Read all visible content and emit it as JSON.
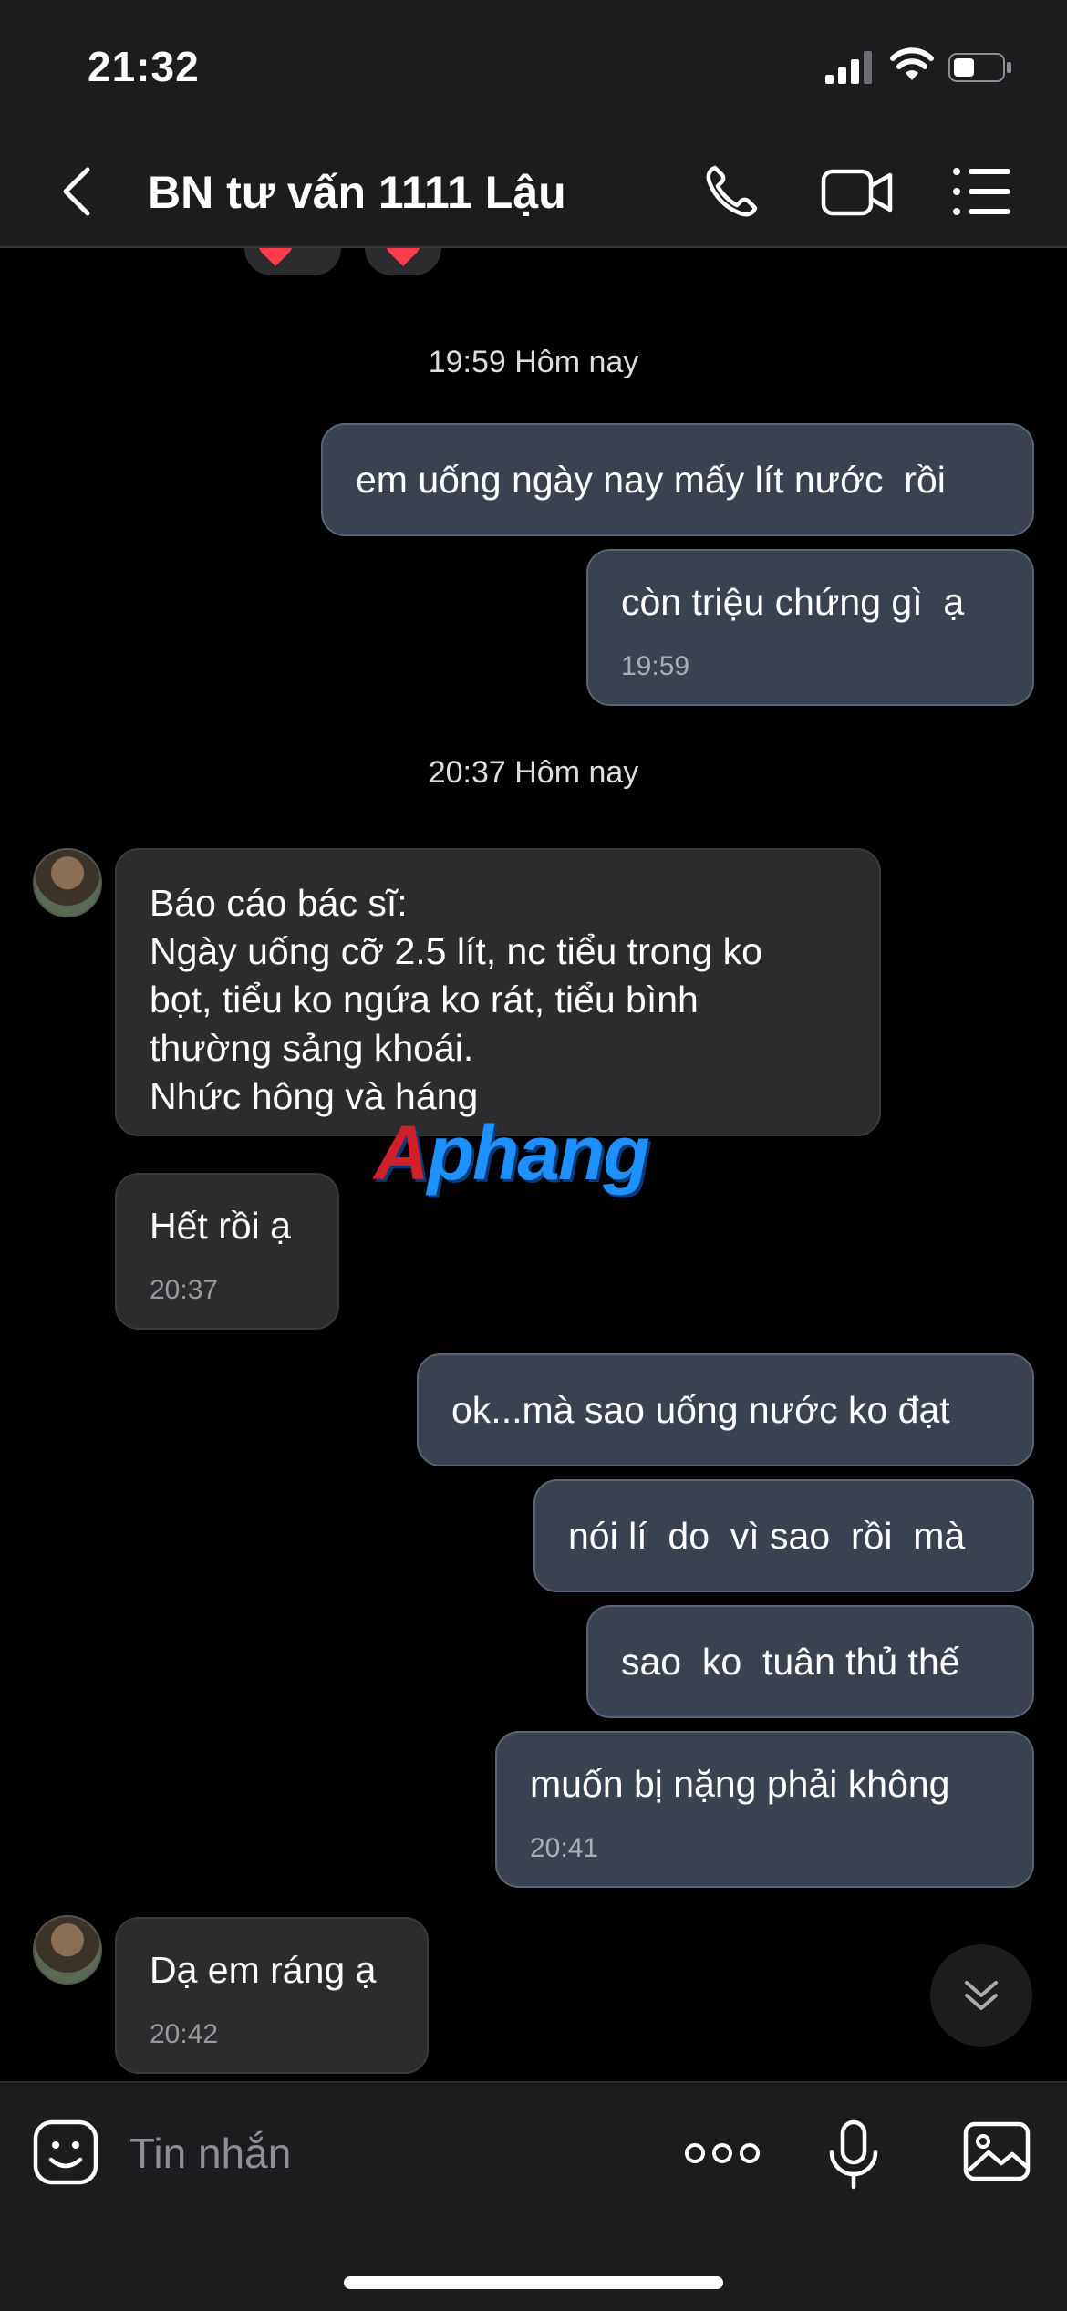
{
  "status_bar": {
    "time": "21:32"
  },
  "header": {
    "title": "BN tư vấn 1111 Lậu"
  },
  "messages": [
    {
      "type": "timestamp",
      "text": "19:59 Hôm nay"
    },
    {
      "type": "outgoing",
      "text": "em uống ngày nay mấy lít nước  rồi"
    },
    {
      "type": "outgoing",
      "text": "còn triệu chứng gì  ạ",
      "time": "19:59"
    },
    {
      "type": "timestamp",
      "text": "20:37 Hôm nay"
    },
    {
      "type": "incoming",
      "text": "Báo cáo bác sĩ:\nNgày uống cỡ 2.5 lít, nc tiểu trong ko\nbọt, tiểu ko ngứa ko rát, tiểu bình\nthường sảng khoái.\nNhức hông và háng"
    },
    {
      "type": "incoming",
      "text": "Hết rồi ạ",
      "time": "20:37"
    },
    {
      "type": "outgoing",
      "text": "ok...mà sao uống nước ko đạt"
    },
    {
      "type": "outgoing",
      "text": "nói lí  do  vì sao  rồi  mà"
    },
    {
      "type": "outgoing",
      "text": "sao  ko  tuân thủ thế"
    },
    {
      "type": "outgoing",
      "text": "muốn bị nặng phải không",
      "time": "20:41"
    },
    {
      "type": "incoming",
      "text": "Dạ em ráng ạ",
      "time": "20:42"
    }
  ],
  "watermark": {
    "part1": "A",
    "part2": "phang"
  },
  "input": {
    "placeholder": "Tin nhắn"
  },
  "colors": {
    "outgoing_bubble": "#3a4250",
    "incoming_bubble": "#2c2c2e",
    "background": "#000000"
  }
}
